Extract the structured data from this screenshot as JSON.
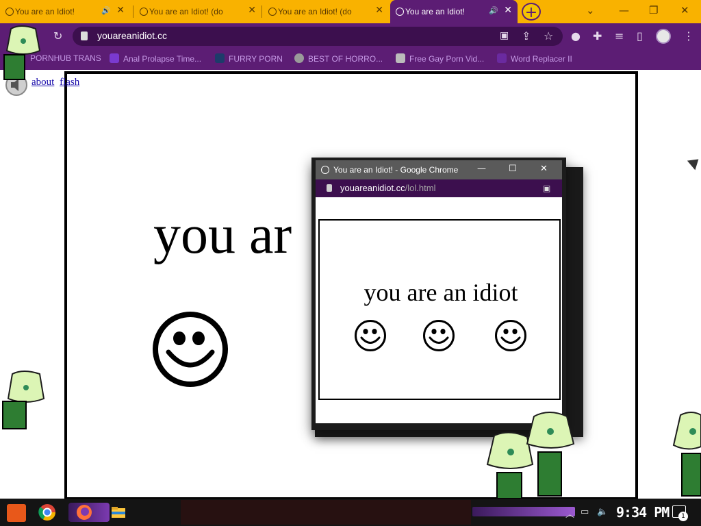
{
  "browser": {
    "tabs": [
      {
        "label": "You are an Idiot!",
        "active": false,
        "audio": true
      },
      {
        "label": "You are an Idiot! (do",
        "active": false,
        "audio": false
      },
      {
        "label": "You are an Idiot! (do",
        "active": false,
        "audio": false
      },
      {
        "label": "You are an Idiot!",
        "active": true,
        "audio": true
      }
    ],
    "new_tab_icon": "plus-icon",
    "tab_close_glyph": "✕",
    "audio_glyph": "🔊",
    "address": {
      "url": "youareanidiot.cc"
    },
    "bookmarks": [
      {
        "label": "PORNHUB TRANS",
        "icon": "bookmark-icon"
      },
      {
        "label": "Anal Prolapse Time...",
        "icon": "bookmark-icon"
      },
      {
        "label": "FURRY PORN",
        "icon": "bookmark-icon"
      },
      {
        "label": "BEST OF HORRO...",
        "icon": "globe-icon"
      },
      {
        "label": "Free Gay Porn Vid...",
        "icon": "bookmark-icon"
      },
      {
        "label": "Word Replacer II",
        "icon": "extension-icon"
      }
    ],
    "colors": {
      "tab_strip": "#f9b200",
      "theme": "#5c1d74",
      "bookmark_text": "#c69ae6"
    }
  },
  "page": {
    "links": [
      "about",
      "flash"
    ],
    "main_text": "you ar"
  },
  "popup": {
    "title": "You are an Idiot! - Google Chrome",
    "url_domain": "youareanidiot.cc",
    "url_path": "/lol.html",
    "text": "you are an idiot",
    "smiley_count": 3
  },
  "taskbar": {
    "time": "9:34 PM",
    "notification_count": "1"
  }
}
